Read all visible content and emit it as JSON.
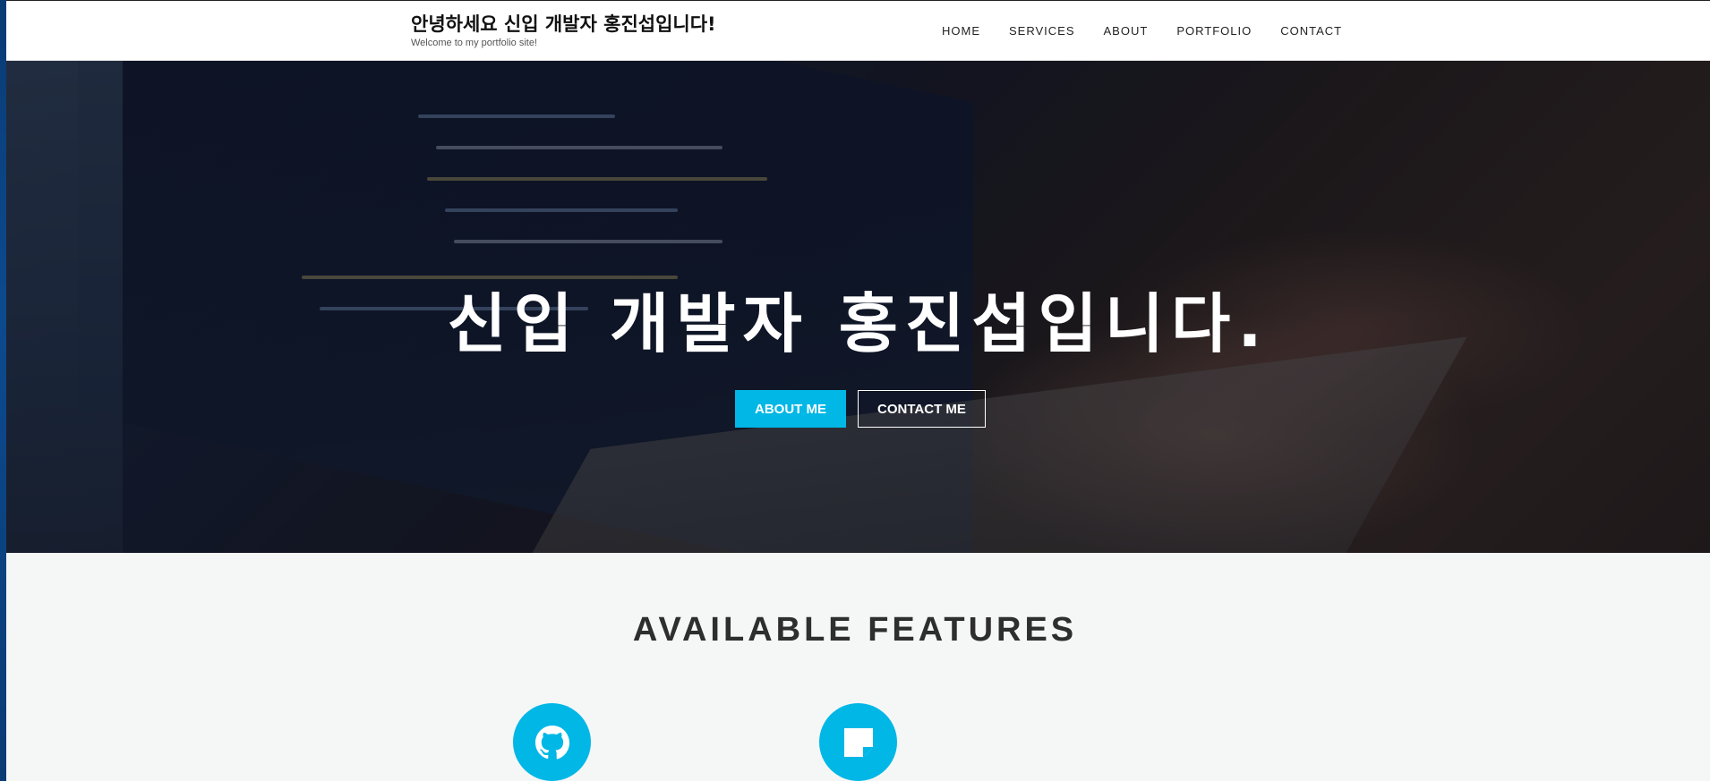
{
  "header": {
    "title": "안녕하세요 신입 개발자 홍진섭입니다!",
    "subtitle": "Welcome to my portfolio site!"
  },
  "nav": {
    "items": [
      {
        "label": "HOME"
      },
      {
        "label": "SERVICES"
      },
      {
        "label": "ABOUT"
      },
      {
        "label": "PORTFOLIO"
      },
      {
        "label": "CONTACT"
      }
    ]
  },
  "hero": {
    "headline": "신입 개발자 홍진섭입니다.",
    "primary_button": "ABOUT ME",
    "secondary_button": "CONTACT ME"
  },
  "features": {
    "title": "AVAILABLE FEATURES",
    "items": [
      {
        "icon": "github-icon"
      },
      {
        "icon": "note-icon"
      }
    ]
  },
  "colors": {
    "accent": "#00b7e6",
    "heading": "#2e2e2e",
    "section_bg": "#f5f7f7"
  }
}
